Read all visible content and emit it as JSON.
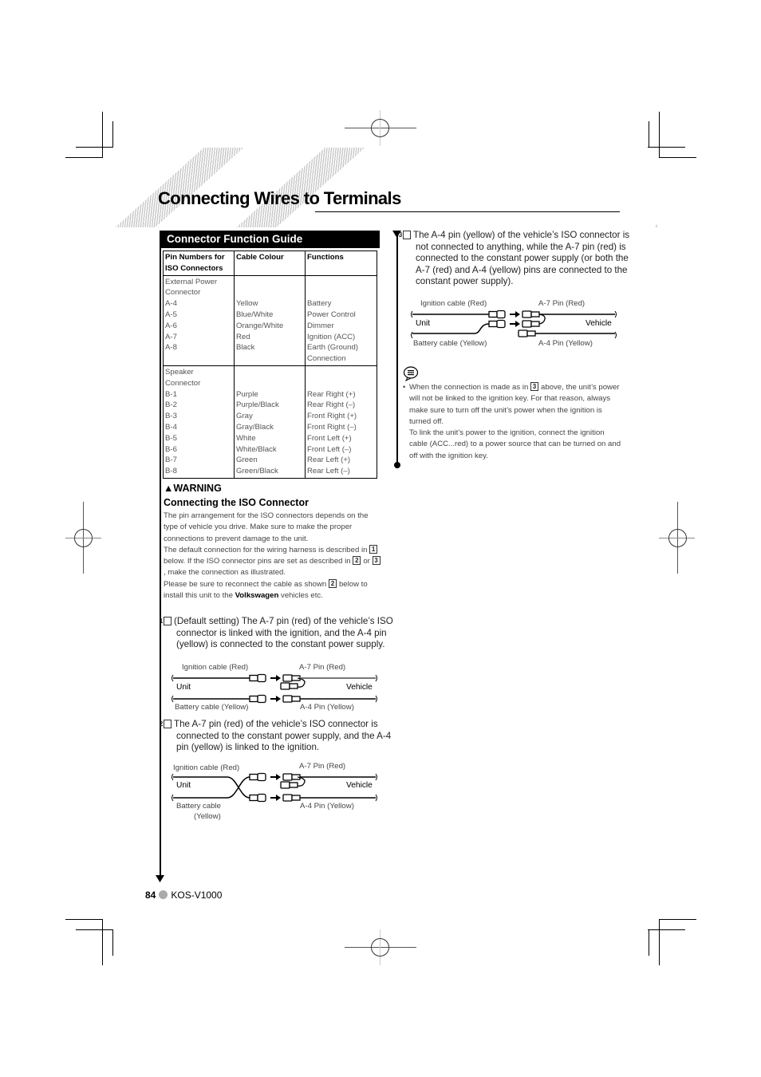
{
  "page": {
    "title": "Connecting Wires to Terminals",
    "side_mark": "⁴",
    "footer": {
      "page_number": "84",
      "model": "KOS-V1000"
    }
  },
  "guide": {
    "heading": "Connector Function Guide",
    "columns": [
      "Pin Numbers for ISO Connectors",
      "Cable Colour",
      "Functions"
    ],
    "groups": [
      {
        "name": "External Power Connector",
        "rows": [
          {
            "pin": "A-4",
            "colour": "Yellow",
            "function": "Battery"
          },
          {
            "pin": "A-5",
            "colour": "Blue/White",
            "function": "Power Control"
          },
          {
            "pin": "A-6",
            "colour": "Orange/White",
            "function": "Dimmer"
          },
          {
            "pin": "A-7",
            "colour": "Red",
            "function": "Ignition (ACC)"
          },
          {
            "pin": "A-8",
            "colour": "Black",
            "function": "Earth (Ground) Connection"
          }
        ]
      },
      {
        "name": "Speaker Connector",
        "rows": [
          {
            "pin": "B-1",
            "colour": "Purple",
            "function": "Rear Right (+)"
          },
          {
            "pin": "B-2",
            "colour": "Purple/Black",
            "function": "Rear Right (–)"
          },
          {
            "pin": "B-3",
            "colour": "Gray",
            "function": "Front Right (+)"
          },
          {
            "pin": "B-4",
            "colour": "Gray/Black",
            "function": "Front Right (–)"
          },
          {
            "pin": "B-5",
            "colour": "White",
            "function": "Front Left (+)"
          },
          {
            "pin": "B-6",
            "colour": "White/Black",
            "function": "Front Left (–)"
          },
          {
            "pin": "B-7",
            "colour": "Green",
            "function": "Rear Left (+)"
          },
          {
            "pin": "B-8",
            "colour": "Green/Black",
            "function": "Rear Left (–)"
          }
        ]
      }
    ]
  },
  "warning": {
    "label": "WARNING",
    "heading": "Connecting the ISO Connector",
    "p1": "The pin arrangement for the ISO connectors depends on the type of vehicle you drive. Make sure to make the proper connections to prevent damage to the unit.",
    "p2a": "The default connection for the wiring harness is described in",
    "p2b": "below. If the ISO connector pins are set as described in",
    "p2c": "or",
    "p2d": ", make the connection as illustrated.",
    "p3a": "Please be sure to reconnect the cable as shown",
    "p3b": "below to install this unit to the",
    "p3_brand": "Volkswagen",
    "p3c": "vehicles etc."
  },
  "cases": [
    {
      "num": "1",
      "text": "(Default setting) The A-7 pin (red) of the vehicle’s ISO connector is linked with the ignition, and the A-4 pin (yellow) is connected to the constant power supply.",
      "labels": {
        "top_left": "Ignition cable (Red)",
        "top_right": "A-7 Pin (Red)",
        "unit": "Unit",
        "vehicle": "Vehicle",
        "bottom_left": "Battery cable (Yellow)",
        "bottom_right": "A-4 Pin (Yellow)"
      }
    },
    {
      "num": "2",
      "text": "The A-7 pin (red) of the vehicle’s ISO connector is connected to the constant power supply, and the A-4 pin (yellow) is linked to the ignition.",
      "labels": {
        "top_left": "Ignition cable (Red)",
        "top_right": "A-7 Pin (Red)",
        "unit": "Unit",
        "vehicle": "Vehicle",
        "bottom_left": "Battery cable",
        "bottom_left2": "(Yellow)",
        "bottom_right": "A-4 Pin (Yellow)"
      }
    },
    {
      "num": "3",
      "text": "The A-4 pin (yellow) of the vehicle’s ISO connector is not connected to anything, while the A-7 pin (red) is connected to the constant power supply (or both the A-7 (red) and A-4 (yellow) pins are connected to the constant power supply).",
      "labels": {
        "top_left": "Ignition cable (Red)",
        "top_right": "A-7 Pin (Red)",
        "unit": "Unit",
        "vehicle": "Vehicle",
        "bottom_left": "Battery cable (Yellow)",
        "bottom_right": "A-4 Pin (Yellow)"
      }
    }
  ],
  "note": {
    "icon": "note-icon",
    "bullet": "•",
    "t1a": "When the connection is made as in",
    "t1b": "above, the unit’s power will not be linked to the ignition key. For that reason, always make sure to turn off the unit’s power when the ignition is turned off.",
    "t2": "To link the unit’s power to the ignition, connect the ignition cable (ACC...red) to a power source that can be turned on and off with the ignition key."
  }
}
